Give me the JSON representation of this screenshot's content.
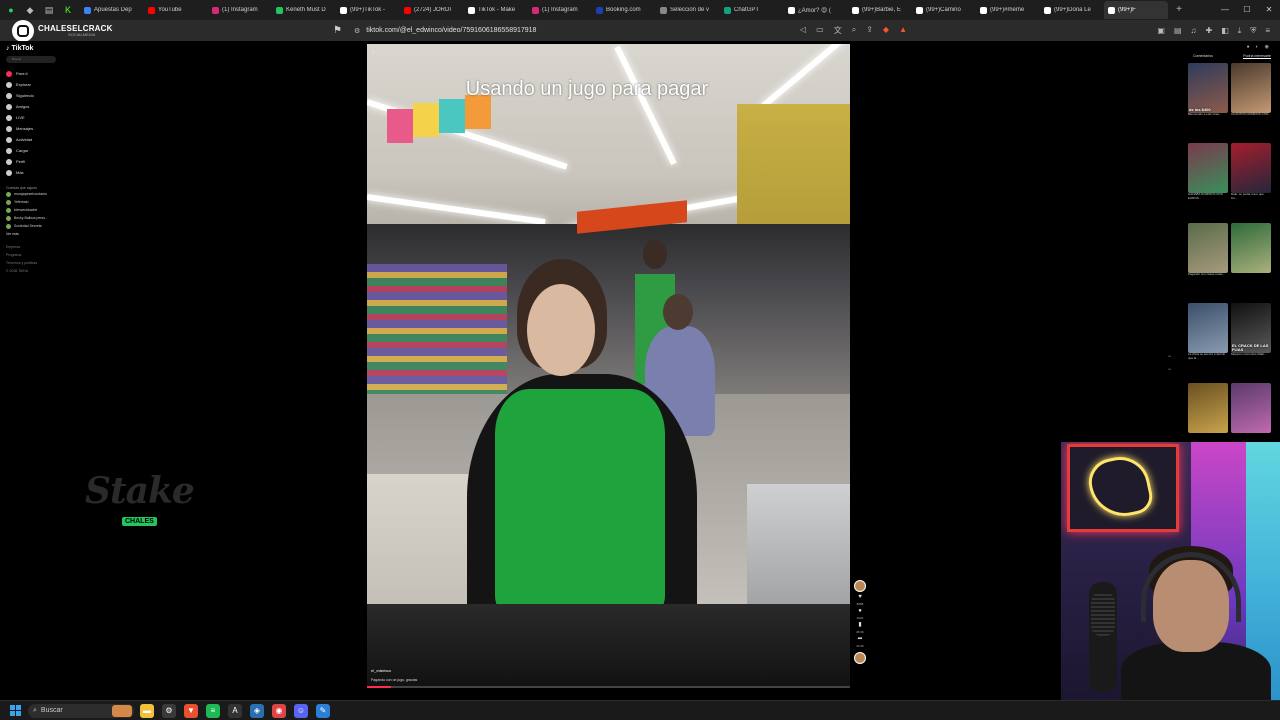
{
  "browser": {
    "tabs": [
      {
        "label": "Apuestas Dep",
        "color": "#3b82f6"
      },
      {
        "label": "YouTube",
        "color": "#ff0000"
      },
      {
        "label": "(1) Instagram",
        "color": "#d62976"
      },
      {
        "label": "Keneth Must D",
        "color": "#22c55e"
      },
      {
        "label": "(99+)TikTok -",
        "color": "#ffffff"
      },
      {
        "label": "(2724) JORDI",
        "color": "#ff0000"
      },
      {
        "label": "TikTok - Make",
        "color": "#ffffff"
      },
      {
        "label": "(1) Instagram",
        "color": "#d62976"
      },
      {
        "label": "Booking.com",
        "color": "#1e40af"
      },
      {
        "label": "Selección de v",
        "color": "#888888"
      },
      {
        "label": "ChatGPT",
        "color": "#10a37f"
      },
      {
        "label": "¿Amor? 😍 (",
        "color": "#ffffff"
      },
      {
        "label": "(99+)Barbie, E",
        "color": "#ffffff"
      },
      {
        "label": "(99+)Camino",
        "color": "#ffffff"
      },
      {
        "label": "(99+)#meme",
        "color": "#ffffff"
      },
      {
        "label": "(99+)Dona Le",
        "color": "#ffffff"
      },
      {
        "label": "(99+)F",
        "color": "#ffffff",
        "active": true
      }
    ],
    "new_tab": "+",
    "url": "tiktok.com/@el_edwinco/video/7591606186558917918",
    "window_buttons": [
      "—",
      "☐",
      "✕"
    ]
  },
  "channel": {
    "name": "CHALESELCRACK",
    "tag": "SOCIALMEDIA"
  },
  "sidebar": {
    "logo": "TikTok",
    "search_placeholder": "Buscar",
    "nav": [
      {
        "label": "Para ti",
        "color": "#fe2c55"
      },
      {
        "label": "Explorar",
        "color": "#cccccc"
      },
      {
        "label": "Siguiendo",
        "color": "#cccccc"
      },
      {
        "label": "Amigos",
        "color": "#cccccc"
      },
      {
        "label": "LIVE",
        "color": "#cccccc"
      },
      {
        "label": "Mensajes",
        "color": "#cccccc"
      },
      {
        "label": "Actividad",
        "color": "#cccccc"
      },
      {
        "label": "Cargar",
        "color": "#cccccc"
      },
      {
        "label": "Perfil",
        "color": "#cccccc"
      },
      {
        "label": "Más",
        "color": "#cccccc"
      }
    ],
    "following_title": "Cuentas que sigues",
    "accounts": [
      "morajapesehondamo",
      "Yefersalo",
      "bienvenidowiet",
      "Becky Balboa perso..",
      "Sociedad Secreta"
    ],
    "see_more": "Ver más",
    "footer": [
      "Empresa",
      "Programa",
      "Términos y políticas",
      "© 2026 TikTok"
    ]
  },
  "stake": {
    "word": "Stake",
    "tag": "CHALES"
  },
  "video": {
    "caption": "Usando un jugo para pagar",
    "author": "el_edwinco",
    "description": "Pagando con un jugo, gracias",
    "progress": 0.05
  },
  "actions": {
    "items": [
      {
        "icon": "♥",
        "count": "8888"
      },
      {
        "icon": "●",
        "count": "4620"
      },
      {
        "icon": "▮",
        "count": "38.3K"
      },
      {
        "icon": "➦",
        "count": "43.5K"
      }
    ]
  },
  "right_panel": {
    "tabs": [
      "Comentarios",
      "Podría interesarte"
    ],
    "thumbs": [
      {
        "title": "de los $400",
        "caption": "Bienvenido a este Gran...",
        "c1": "#2f3b5c",
        "c2": "#8d5b4a"
      },
      {
        "title": "",
        "caption": "CUANTOS DOMINOS CON...",
        "c1": "#4a3a2c",
        "c2": "#c59a74"
      },
      {
        "title": "",
        "caption": "GANABA DOMINOS DOS EUROS...",
        "c1": "#7a3a4d",
        "c2": "#3a8f5b"
      },
      {
        "title": "",
        "caption": "Dale, se podía creer que los...",
        "c1": "#a51e2d",
        "c2": "#23273a"
      },
      {
        "title": "",
        "caption": "Pagando con casas rosas...",
        "c1": "#5a6b4a",
        "c2": "#a79a7c"
      },
      {
        "title": "",
        "caption": "",
        "c1": "#2f6a3a",
        "c2": "#aab17c"
      },
      {
        "title": "",
        "caption": "La chica se acercó a decirle que la...",
        "c1": "#3a4f6a",
        "c2": "#8a9bb0"
      },
      {
        "title": "EL CRACK DE LAS FIJAS",
        "caption": "Mejores momentos Madr...",
        "c1": "#111111",
        "c2": "#5a5a5a"
      },
      {
        "title": "",
        "caption": "",
        "c1": "#6a5020",
        "c2": "#c9a34d"
      },
      {
        "title": "",
        "caption": "",
        "c1": "#5a3a6a",
        "c2": "#c06ab0"
      }
    ]
  },
  "taskbar": {
    "search": "Buscar",
    "apps": [
      {
        "name": "file-explorer",
        "color": "#f0c23a",
        "glyph": "▬"
      },
      {
        "name": "settings",
        "color": "#3a3a3a",
        "glyph": "⚙"
      },
      {
        "name": "brave",
        "color": "#e8502e",
        "glyph": "▼"
      },
      {
        "name": "spotify",
        "color": "#1db954",
        "glyph": "≡"
      },
      {
        "name": "armoury",
        "color": "#333333",
        "glyph": "A"
      },
      {
        "name": "network",
        "color": "#2a6fb0",
        "glyph": "◈"
      },
      {
        "name": "chrome",
        "color": "#d44",
        "glyph": "◉"
      },
      {
        "name": "discord",
        "color": "#5865f2",
        "glyph": "☺"
      },
      {
        "name": "vscode",
        "color": "#2b7fd6",
        "glyph": "✎"
      }
    ]
  }
}
